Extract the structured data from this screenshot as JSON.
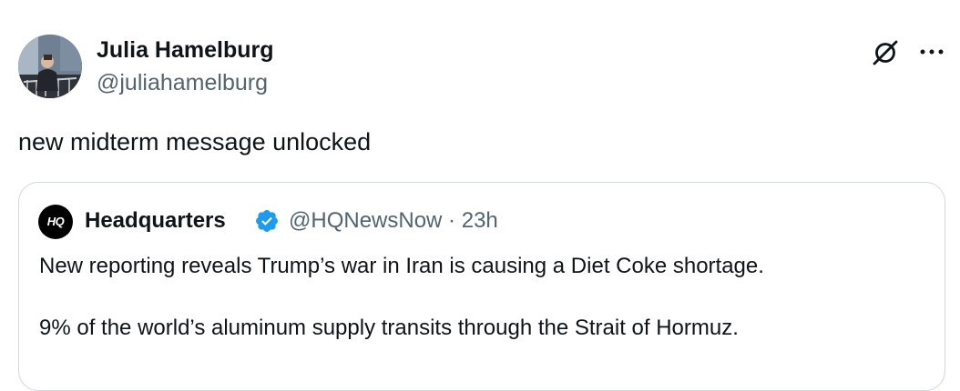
{
  "post": {
    "author": {
      "name": "Julia Hamelburg",
      "handle": "@juliahamelburg",
      "avatar": "profile-photo"
    },
    "text": "new midterm message unlocked",
    "actions": {
      "grok_icon": "grok-icon",
      "more_icon": "more-horizontal-icon"
    }
  },
  "quoted_post": {
    "author": {
      "name": "Headquarters",
      "avatar_text": "HQ",
      "verified": true,
      "verified_color": "#1d9bf0"
    },
    "meta": "@HQNewsNow · 23h",
    "text_lines": [
      "New reporting reveals Trump’s war in Iran is causing a Diet Coke shortage.",
      "9% of the world’s aluminum supply transits through the Strait of Hormuz."
    ]
  },
  "colors": {
    "text": "#0f1419",
    "secondary_text": "#536471",
    "border": "#cfd9de",
    "verified": "#1d9bf0"
  }
}
